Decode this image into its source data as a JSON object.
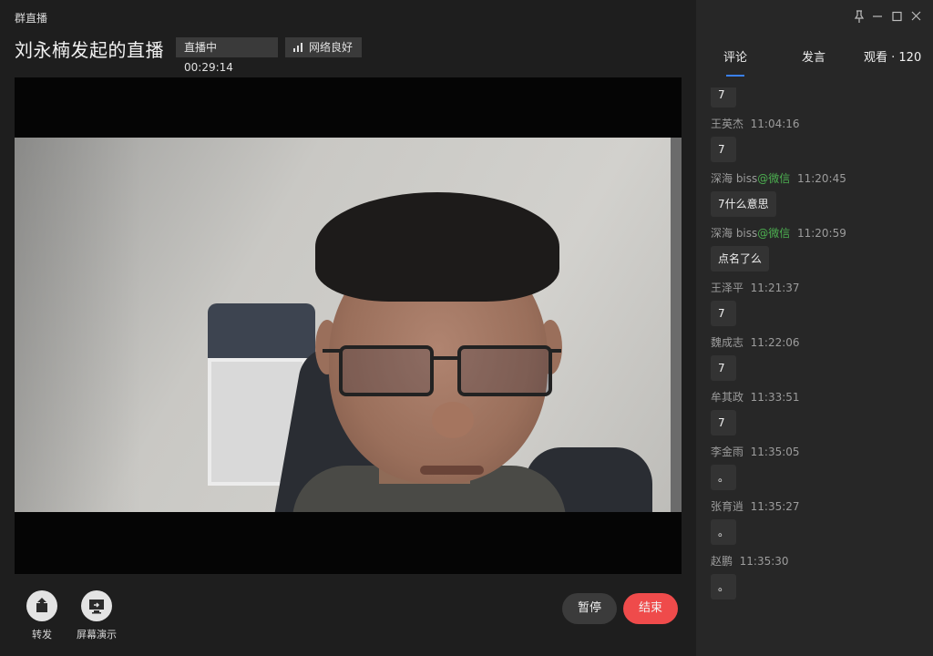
{
  "app_title": "群直播",
  "live_title": "刘永楠发起的直播",
  "status": {
    "label": "直播中",
    "duration": "00:29:14"
  },
  "network": {
    "label": "网络良好"
  },
  "tabs": [
    {
      "label": "评论"
    },
    {
      "label": "发言"
    },
    {
      "label": "观看 · 120"
    }
  ],
  "comments": [
    {
      "user": "",
      "time": "",
      "text": "7"
    },
    {
      "user": "王英杰",
      "time": "11:04:16",
      "text": "7"
    },
    {
      "user": "深海 biss",
      "source": "@微信",
      "time": "11:20:45",
      "text": "7什么意思"
    },
    {
      "user": "深海 biss",
      "source": "@微信",
      "time": "11:20:59",
      "text": "点名了么"
    },
    {
      "user": "王泽平",
      "time": "11:21:37",
      "text": "7"
    },
    {
      "user": "魏成志",
      "time": "11:22:06",
      "text": "7"
    },
    {
      "user": "牟其政",
      "time": "11:33:51",
      "text": "7"
    },
    {
      "user": "李金雨",
      "time": "11:35:05",
      "text": "。"
    },
    {
      "user": "张育逍",
      "time": "11:35:27",
      "text": "。"
    },
    {
      "user": "赵鹏",
      "time": "11:35:30",
      "text": "。"
    }
  ],
  "controls": {
    "forward_label": "转发",
    "screen_share_label": "屏幕演示",
    "pause_label": "暂停",
    "end_label": "结束"
  },
  "colors": {
    "accent": "#3a80f2",
    "end_button": "#ef4b4b",
    "source_tag": "#4caf50"
  },
  "icons": [
    "pin-icon",
    "minimize-icon",
    "maximize-icon",
    "close-icon",
    "signal-icon",
    "share-icon",
    "screen-share-icon"
  ]
}
